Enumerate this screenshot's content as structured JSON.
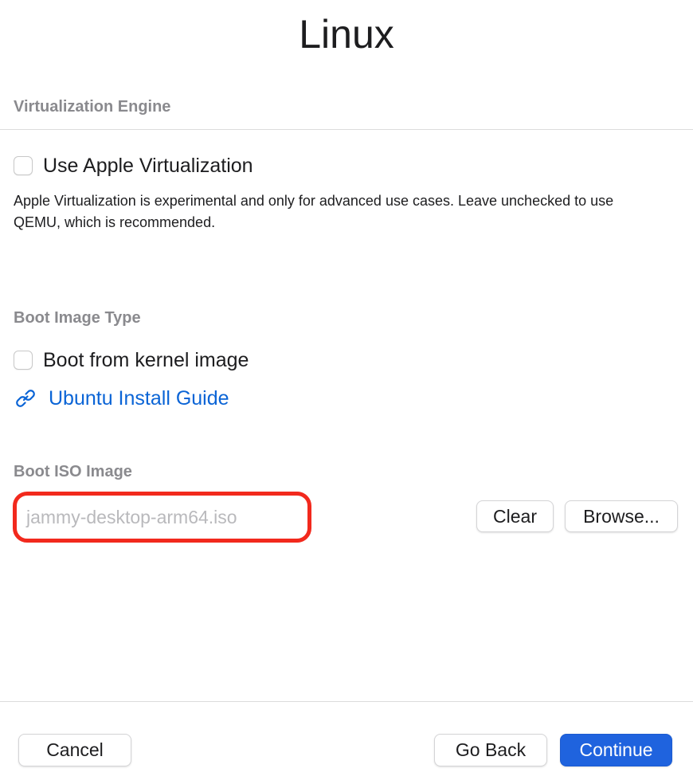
{
  "header": {
    "title": "Linux"
  },
  "virtualization": {
    "section_label": "Virtualization Engine",
    "apple_virtualization": {
      "label": "Use Apple Virtualization",
      "checked": false
    },
    "help_text": "Apple Virtualization is experimental and only for advanced use cases. Leave unchecked to use QEMU, which is recommended."
  },
  "boot_image_type": {
    "section_label": "Boot Image Type",
    "kernel_image": {
      "label": "Boot from kernel image",
      "checked": false
    },
    "guide_link": {
      "label": "Ubuntu Install Guide",
      "icon": "link-icon"
    }
  },
  "boot_iso": {
    "section_label": "Boot ISO Image",
    "placeholder": "jammy-desktop-arm64.iso",
    "clear_label": "Clear",
    "browse_label": "Browse..."
  },
  "footer": {
    "cancel_label": "Cancel",
    "go_back_label": "Go Back",
    "continue_label": "Continue"
  },
  "colors": {
    "accent": "#1f63de",
    "link": "#0a64d6",
    "highlight_outline": "#f2291d",
    "section_label": "#8a8a8e"
  }
}
